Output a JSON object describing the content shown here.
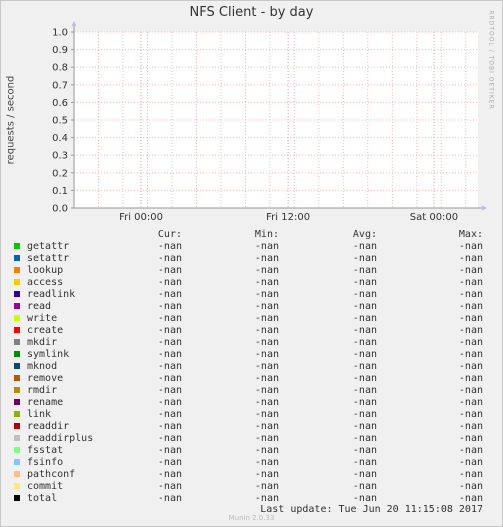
{
  "chart_data": {
    "type": "line",
    "title": "NFS Client - by day",
    "ylabel": "requests / second",
    "ylim": [
      0,
      1.0
    ],
    "yticks": [
      "0.0",
      "0.1",
      "0.2",
      "0.3",
      "0.4",
      "0.5",
      "0.6",
      "0.7",
      "0.8",
      "0.9",
      "1.0"
    ],
    "xticks": [
      "Fri 00:00",
      "Fri 12:00",
      "Sat 00:00"
    ],
    "grid": true,
    "series": []
  },
  "side_text": "RRDTOOL / TOBI OETIKER",
  "legend": {
    "headers": [
      "Cur:",
      "Min:",
      "Avg:",
      "Max:"
    ],
    "rows": [
      {
        "name": "getattr",
        "color": "#00cc00",
        "cur": "-nan",
        "min": "-nan",
        "avg": "-nan",
        "max": "-nan"
      },
      {
        "name": "setattr",
        "color": "#0066b3",
        "cur": "-nan",
        "min": "-nan",
        "avg": "-nan",
        "max": "-nan"
      },
      {
        "name": "lookup",
        "color": "#ff8000",
        "cur": "-nan",
        "min": "-nan",
        "avg": "-nan",
        "max": "-nan"
      },
      {
        "name": "access",
        "color": "#ffcc00",
        "cur": "-nan",
        "min": "-nan",
        "avg": "-nan",
        "max": "-nan"
      },
      {
        "name": "readlink",
        "color": "#330099",
        "cur": "-nan",
        "min": "-nan",
        "avg": "-nan",
        "max": "-nan"
      },
      {
        "name": "read",
        "color": "#990099",
        "cur": "-nan",
        "min": "-nan",
        "avg": "-nan",
        "max": "-nan"
      },
      {
        "name": "write",
        "color": "#ccff00",
        "cur": "-nan",
        "min": "-nan",
        "avg": "-nan",
        "max": "-nan"
      },
      {
        "name": "create",
        "color": "#ff0000",
        "cur": "-nan",
        "min": "-nan",
        "avg": "-nan",
        "max": "-nan"
      },
      {
        "name": "mkdir",
        "color": "#808080",
        "cur": "-nan",
        "min": "-nan",
        "avg": "-nan",
        "max": "-nan"
      },
      {
        "name": "symlink",
        "color": "#008f00",
        "cur": "-nan",
        "min": "-nan",
        "avg": "-nan",
        "max": "-nan"
      },
      {
        "name": "mknod",
        "color": "#00487d",
        "cur": "-nan",
        "min": "-nan",
        "avg": "-nan",
        "max": "-nan"
      },
      {
        "name": "remove",
        "color": "#b35a00",
        "cur": "-nan",
        "min": "-nan",
        "avg": "-nan",
        "max": "-nan"
      },
      {
        "name": "rmdir",
        "color": "#b38f00",
        "cur": "-nan",
        "min": "-nan",
        "avg": "-nan",
        "max": "-nan"
      },
      {
        "name": "rename",
        "color": "#6b006b",
        "cur": "-nan",
        "min": "-nan",
        "avg": "-nan",
        "max": "-nan"
      },
      {
        "name": "link",
        "color": "#8fb300",
        "cur": "-nan",
        "min": "-nan",
        "avg": "-nan",
        "max": "-nan"
      },
      {
        "name": "readdir",
        "color": "#b30000",
        "cur": "-nan",
        "min": "-nan",
        "avg": "-nan",
        "max": "-nan"
      },
      {
        "name": "readdirplus",
        "color": "#bebebe",
        "cur": "-nan",
        "min": "-nan",
        "avg": "-nan",
        "max": "-nan"
      },
      {
        "name": "fsstat",
        "color": "#80ff80",
        "cur": "-nan",
        "min": "-nan",
        "avg": "-nan",
        "max": "-nan"
      },
      {
        "name": "fsinfo",
        "color": "#80c9ff",
        "cur": "-nan",
        "min": "-nan",
        "avg": "-nan",
        "max": "-nan"
      },
      {
        "name": "pathconf",
        "color": "#ffc080",
        "cur": "-nan",
        "min": "-nan",
        "avg": "-nan",
        "max": "-nan"
      },
      {
        "name": "commit",
        "color": "#ffe680",
        "cur": "-nan",
        "min": "-nan",
        "avg": "-nan",
        "max": "-nan"
      },
      {
        "name": "total",
        "color": "#000000",
        "cur": "-nan",
        "min": "-nan",
        "avg": "-nan",
        "max": "-nan"
      }
    ]
  },
  "footer": {
    "last_update": "Last update: Tue Jun 20 11:15:08 2017",
    "generator": "Munin 2.0.33"
  }
}
